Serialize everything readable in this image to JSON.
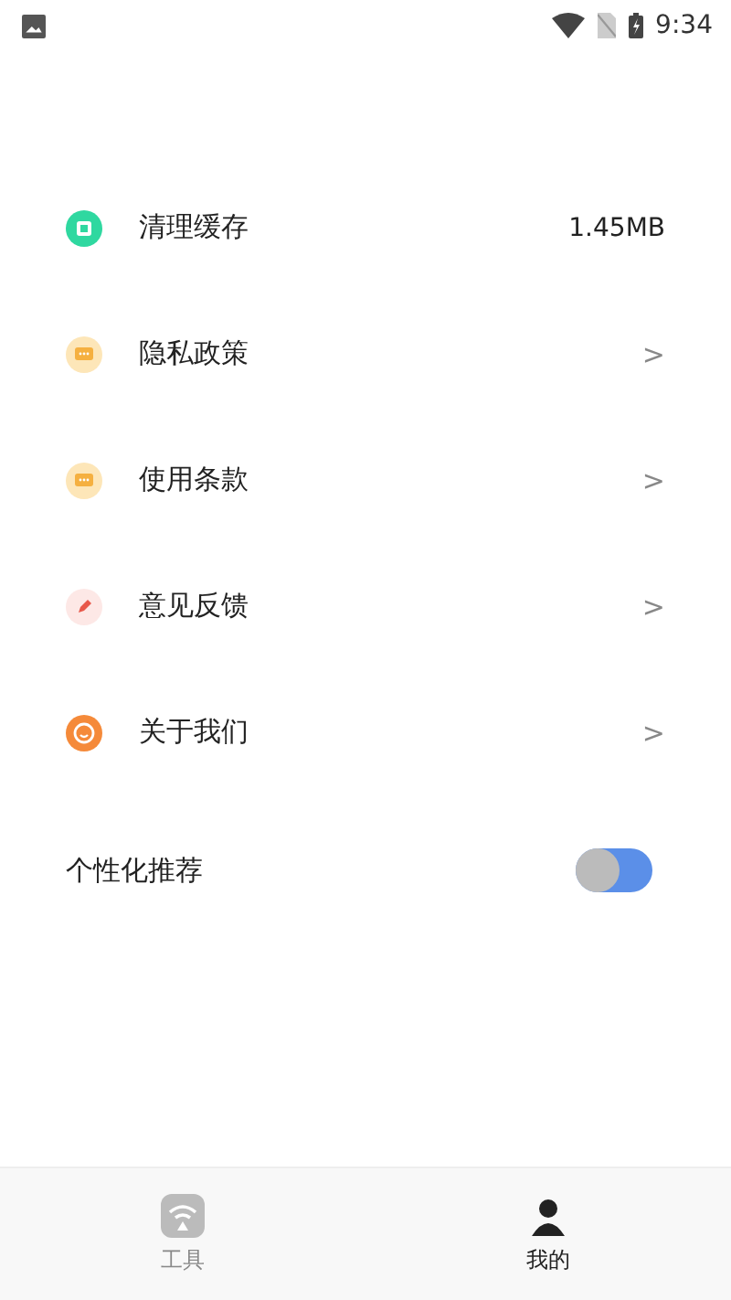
{
  "status_bar": {
    "time": "9:34"
  },
  "settings": [
    {
      "kind": "cache",
      "label": "清理缓存",
      "value": "1.45MB"
    },
    {
      "kind": "privacy",
      "label": "隐私政策",
      "chevron": ">"
    },
    {
      "kind": "terms",
      "label": "使用条款",
      "chevron": ">"
    },
    {
      "kind": "feedback",
      "label": "意见反馈",
      "chevron": ">"
    },
    {
      "kind": "about",
      "label": "关于我们",
      "chevron": ">"
    }
  ],
  "personalized": {
    "label": "个性化推荐",
    "on": false
  },
  "tabs": [
    {
      "kind": "tools",
      "label": "工具",
      "selected": false
    },
    {
      "kind": "mine",
      "label": "我的",
      "selected": true
    }
  ]
}
